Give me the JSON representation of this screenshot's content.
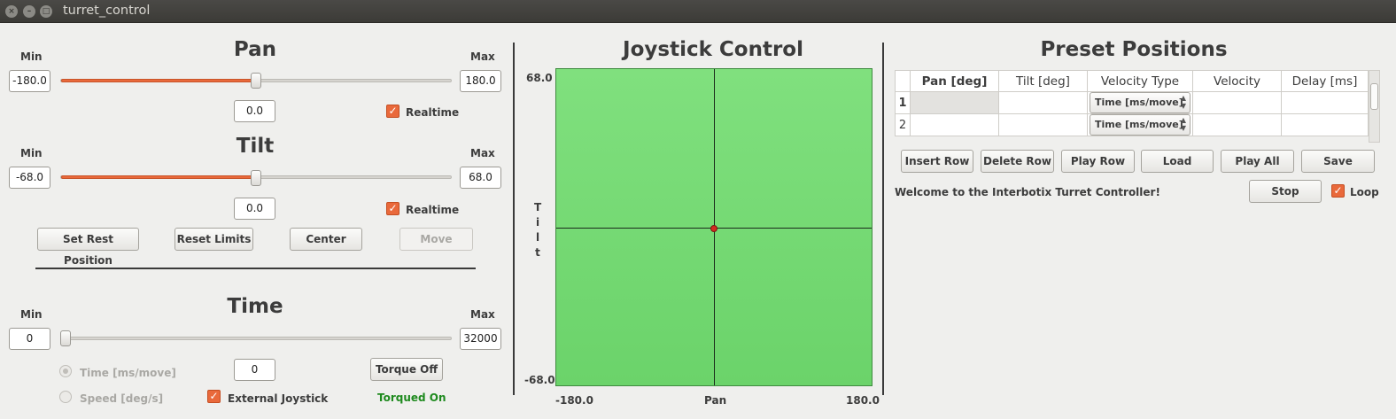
{
  "window": {
    "title": "turret_control"
  },
  "pan": {
    "title": "Pan",
    "min_label": "Min",
    "max_label": "Max",
    "min_value": "-180.0",
    "max_value": "180.0",
    "value": "0.0",
    "realtime_label": "Realtime",
    "realtime_checked": true,
    "slider_fraction": 0.5
  },
  "tilt": {
    "title": "Tilt",
    "min_label": "Min",
    "max_label": "Max",
    "min_value": "-68.0",
    "max_value": "68.0",
    "value": "0.0",
    "realtime_label": "Realtime",
    "realtime_checked": true,
    "slider_fraction": 0.5
  },
  "buttons": {
    "set_rest": "Set Rest Position",
    "reset_limits": "Reset Limits",
    "center": "Center",
    "move": "Move"
  },
  "time": {
    "title": "Time",
    "min_label": "Min",
    "max_label": "Max",
    "min_value": "0",
    "max_value": "32000",
    "value": "0",
    "slider_fraction": 0.0,
    "mode_time": "Time [ms/move]",
    "mode_speed": "Speed [deg/s]",
    "external_joystick": "External Joystick",
    "external_joystick_checked": true,
    "torque_button": "Torque Off",
    "torque_status": "Torqued On"
  },
  "joystick": {
    "title": "Joystick Control",
    "y_max": "68.0",
    "y_min": "-68.0",
    "x_min": "-180.0",
    "x_max": "180.0",
    "x_label": "Pan",
    "y_label": [
      "T",
      "i",
      "l",
      "t"
    ],
    "position": {
      "pan": 0.0,
      "tilt": 0.0
    }
  },
  "presets": {
    "title": "Preset Positions",
    "columns": [
      "Pan [deg]",
      "Tilt [deg]",
      "Velocity Type",
      "Velocity",
      "Delay [ms]"
    ],
    "rows": [
      {
        "index": "1",
        "pan": "",
        "tilt": "",
        "velocity_type": "Time [ms/move]",
        "velocity": "",
        "delay": ""
      },
      {
        "index": "2",
        "pan": "",
        "tilt": "",
        "velocity_type": "Time [ms/move]",
        "velocity": "",
        "delay": ""
      }
    ],
    "buttons": [
      "Insert Row",
      "Delete Row",
      "Play Row",
      "Load",
      "Play All",
      "Save"
    ],
    "status": "Welcome to the Interbotix Turret Controller!",
    "stop": "Stop",
    "loop_label": "Loop",
    "loop_checked": true
  },
  "colors": {
    "accent": "#e9693b",
    "joystick_bg": "#7ada78",
    "torque_status": "#1e8a1e",
    "dot": "#d42b21"
  }
}
